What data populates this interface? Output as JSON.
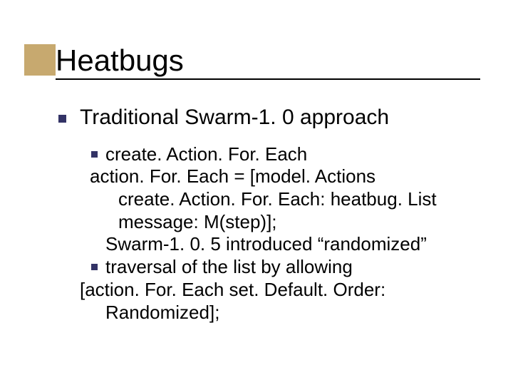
{
  "title": "Heatbugs",
  "bullets": {
    "level1": "Traditional Swarm-1. 0 approach",
    "sub1_line1": "create. Action. For. Each",
    "sub1_line2": "action. For. Each = [model. Actions",
    "sub1_line3": "create. Action. For. Each:  heatbug. List",
    "sub1_line4": "message: M(step)];",
    "sub2_line1": "Swarm-1. 0. 5 introduced “randomized”",
    "sub2_line2": "traversal of the list by allowing",
    "sub2_line3": "[action. For. Each set. Default. Order:",
    "sub2_line4": "Randomized];"
  },
  "colors": {
    "accent_block": "#c7a96f",
    "bullet_square": "#333366"
  }
}
